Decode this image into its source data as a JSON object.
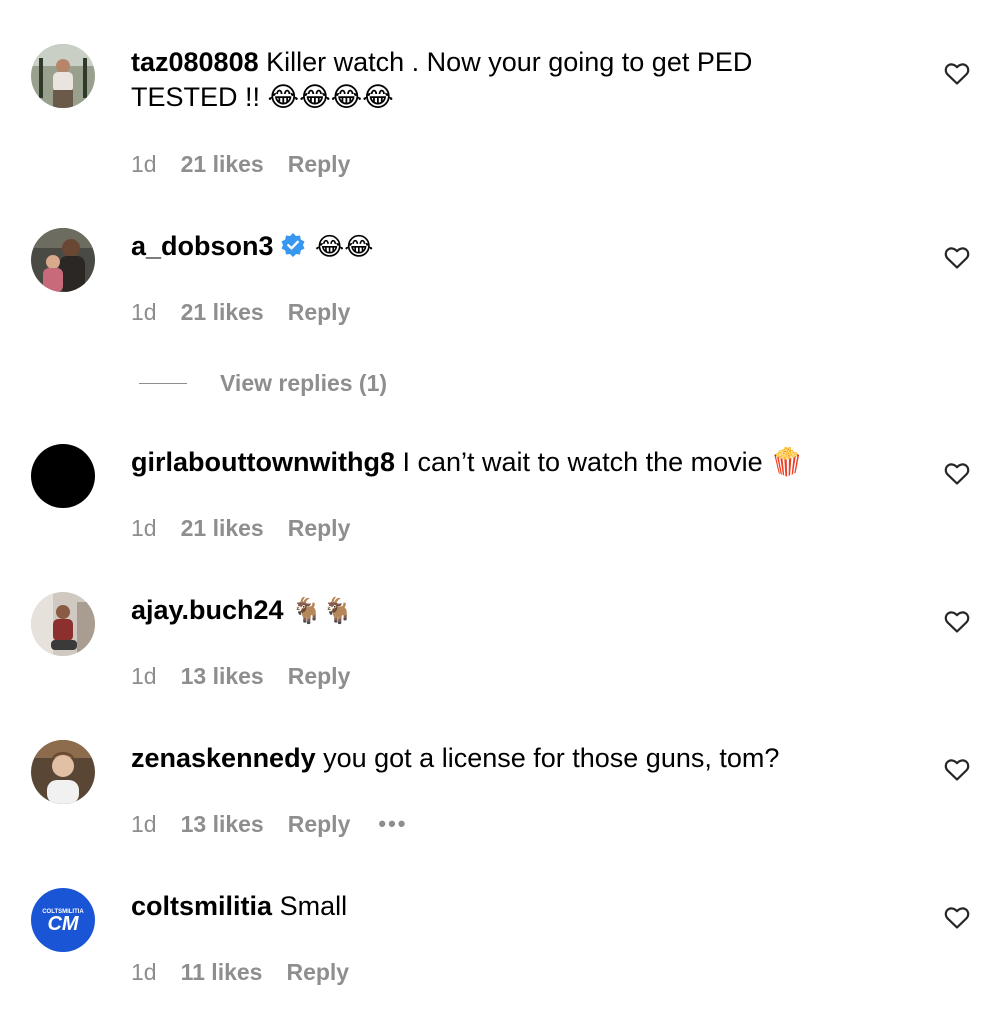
{
  "comments": [
    {
      "username": "taz080808",
      "text": "Killer watch . Now your going to get PED",
      "text2": "TESTED !! 😂😂😂😂",
      "time": "1d",
      "likes": "21 likes",
      "reply": "Reply",
      "avatar_color": "#7a6a58"
    },
    {
      "username": "a_dobson3",
      "verified": true,
      "text": "😂😂",
      "time": "1d",
      "likes": "21 likes",
      "reply": "Reply",
      "avatar_color": "#3d3a36"
    },
    {
      "username": "girlabouttownwithg8",
      "text": "I can’t wait to watch the movie 🍿",
      "time": "1d",
      "likes": "21 likes",
      "reply": "Reply",
      "avatar_color": "#000000"
    },
    {
      "username": "ajay.buch24",
      "text": "🐐🐐",
      "time": "1d",
      "likes": "13 likes",
      "reply": "Reply",
      "avatar_color": "#b9b4ad"
    },
    {
      "username": "zenaskennedy",
      "text": "you got a license for those guns, tom?",
      "time": "1d",
      "likes": "13 likes",
      "reply": "Reply",
      "more": "•••",
      "avatar_color": "#9b8168"
    },
    {
      "username": "coltsmilitia",
      "text": "Small",
      "time": "1d",
      "likes": "11 likes",
      "reply": "Reply",
      "avatar_color": "#1a55d6",
      "avatar_text": "CM",
      "avatar_subtext": "COLTSMILITIA"
    }
  ],
  "view_replies": "View replies (1)",
  "icons": {
    "like": "heart-outline-icon",
    "verified": "verified-badge-icon",
    "more": "more-options-icon"
  },
  "colors": {
    "meta_text": "#8e8e8e",
    "verified": "#3897f0"
  }
}
